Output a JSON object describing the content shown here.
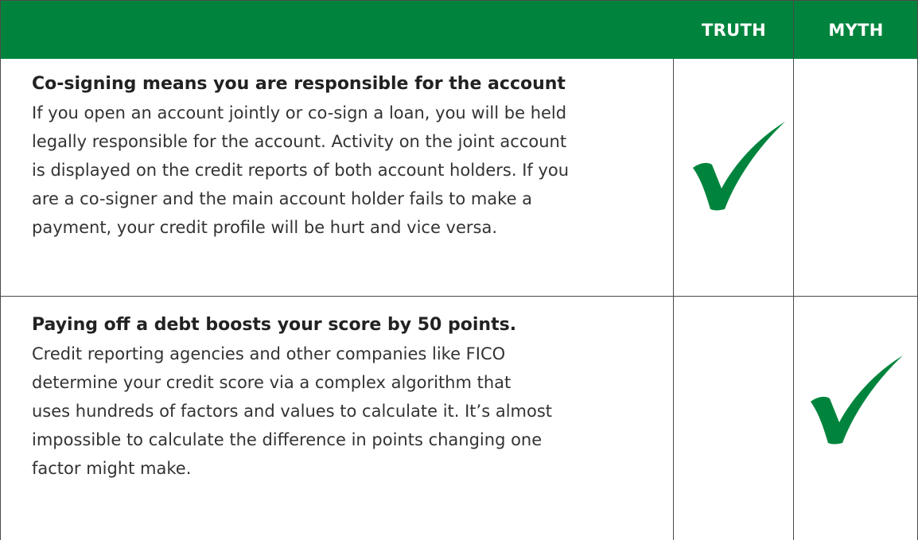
{
  "header": {
    "truth_label": "TRUTH",
    "myth_label": "MYTH",
    "bg_color": "#00843d"
  },
  "rows": [
    {
      "title": "Co-signing means you are responsible for the account",
      "lines": [
        "If you open an account jointly or co-sign a loan, you will be held",
        "legally responsible for the account. Activity on the joint account",
        "is displayed on the credit reports of both account holders. If you",
        "are a co-signer and the main account holder fails to make a",
        "payment, your credit profile will be hurt and vice versa."
      ],
      "verdict": "TRUTH",
      "check_icon": "checkmark-icon",
      "check_color": "#00843d"
    },
    {
      "title": "Paying off a debt boosts your score by 50 points.",
      "lines": [
        "Credit reporting agencies and other companies like FICO",
        "determine your credit score via a complex algorithm that",
        "uses hundreds of factors and values to calculate it. It’s almost",
        "impossible to calculate the difference in points changing one",
        "factor might make."
      ],
      "verdict": "MYTH",
      "check_icon": "checkmark-icon",
      "check_color": "#00843d"
    }
  ]
}
